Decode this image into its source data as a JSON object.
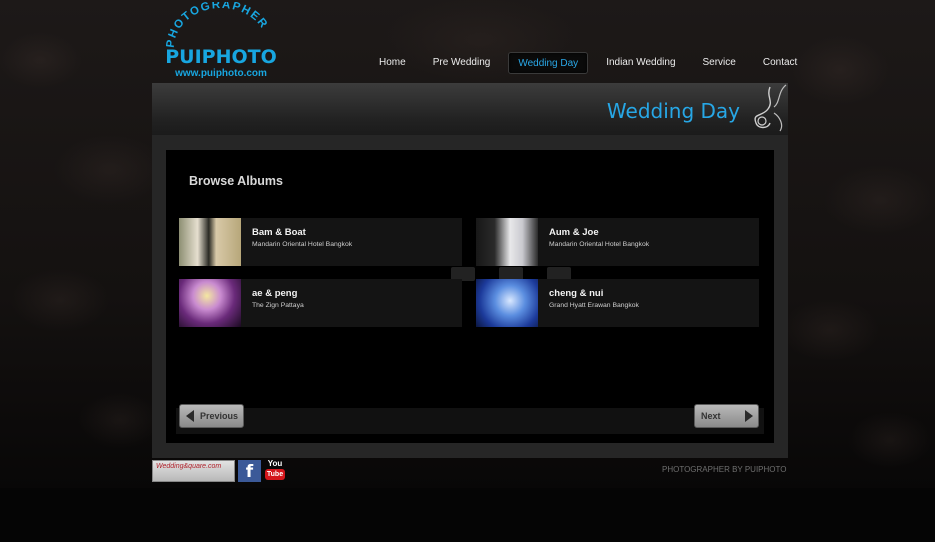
{
  "logo": {
    "ring_text": "PHOTOGRAPHER",
    "main": "PUIPHOTO",
    "url": "www.puiphoto.com"
  },
  "nav": {
    "items": [
      {
        "label": "Home"
      },
      {
        "label": "Pre Wedding"
      },
      {
        "label": "Wedding Day",
        "active": true
      },
      {
        "label": "Indian Wedding"
      },
      {
        "label": "Service"
      },
      {
        "label": "Contact"
      }
    ]
  },
  "page": {
    "title": "Wedding Day"
  },
  "albums": {
    "heading": "Browse Albums",
    "items": [
      {
        "name": "Bam & Boat",
        "place": "Mandarin Oriental Hotel Bangkok"
      },
      {
        "name": "Aum & Joe",
        "place": "Mandarin Oriental Hotel Bangkok"
      },
      {
        "name": "ae & peng",
        "place": "The Zign Pattaya"
      },
      {
        "name": "cheng & nui",
        "place": "Grand Hyatt Erawan Bangkok"
      }
    ]
  },
  "pager": {
    "prev_label": "Previous",
    "next_label": "Next"
  },
  "footer": {
    "wedding_badge": "Wedding&quare.com",
    "facebook_icon": "facebook-icon",
    "youtube_label": "You",
    "youtube_tube": "Tube",
    "credit": "PHOTOGRAPHER BY PUIPHOTO"
  },
  "colors": {
    "accent": "#27a7e6",
    "background": "#050505",
    "panel": "#262626"
  }
}
